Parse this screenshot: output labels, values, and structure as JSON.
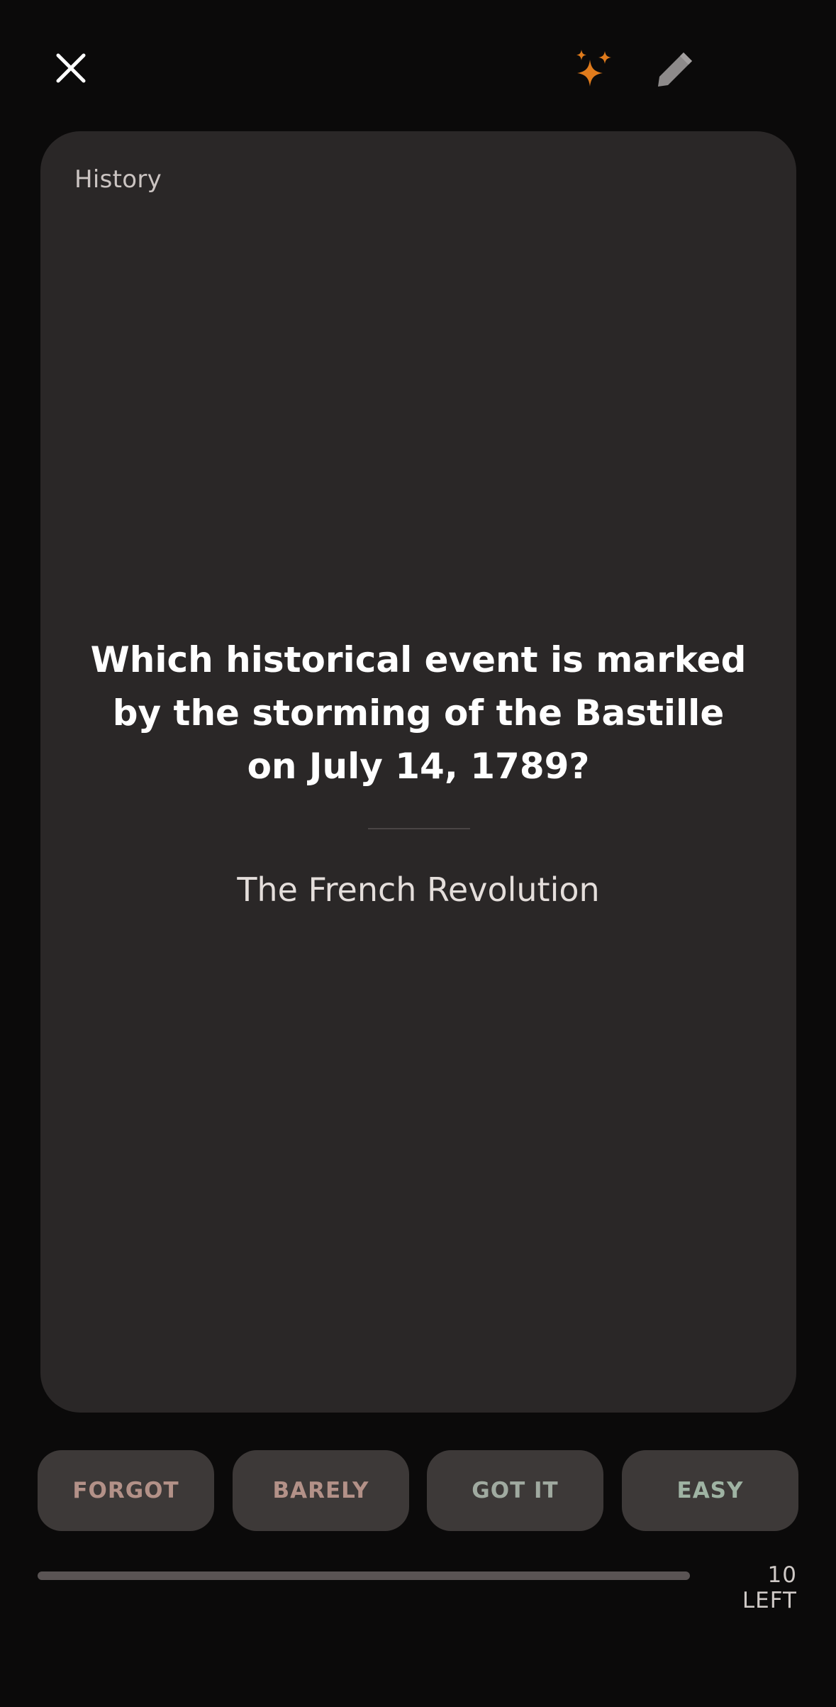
{
  "colors": {
    "background": "#0b0a0a",
    "card": "#2a2727",
    "accent_ai": "#e07b1c",
    "forgot_text": "#b39188",
    "barely_text": "#b39188",
    "gotit_text": "#a0aaa0",
    "easy_text": "#9fb3a3"
  },
  "topbar": {
    "close_icon": "close-icon",
    "ai_icon": "sparkles-icon",
    "edit_icon": "pencil-icon"
  },
  "card": {
    "topic": "History",
    "question": "Which historical event is marked by the storming of the Bastille on July 14, 1789?",
    "answer": "The French Revolution"
  },
  "ratings": {
    "forgot": "FORGOT",
    "barely": "BARELY",
    "got_it": "GOT IT",
    "easy": "EASY"
  },
  "progress": {
    "remaining_label": "10 LEFT"
  }
}
